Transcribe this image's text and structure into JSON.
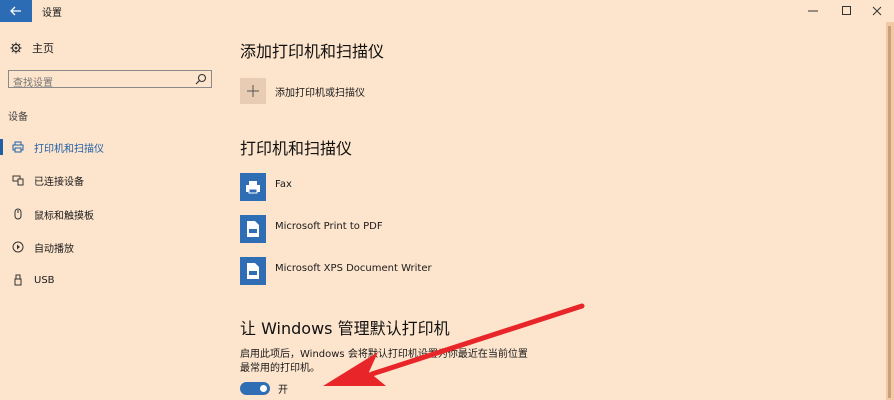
{
  "window": {
    "title": "设置",
    "minimize": "—",
    "maximize": "☐",
    "close": "✕"
  },
  "sidebar": {
    "home_label": "主页",
    "search": {
      "value": "",
      "placeholder": "查找设置"
    },
    "section_label": "设备",
    "items": [
      {
        "label": "打印机和扫描仪",
        "icon": "printer-icon",
        "active": true
      },
      {
        "label": "已连接设备",
        "icon": "connected-devices-icon",
        "active": false
      },
      {
        "label": "鼠标和触摸板",
        "icon": "mouse-icon",
        "active": false
      },
      {
        "label": "自动播放",
        "icon": "autoplay-icon",
        "active": false
      },
      {
        "label": "USB",
        "icon": "usb-icon",
        "active": false
      }
    ]
  },
  "main": {
    "add_heading": "添加打印机和扫描仪",
    "add_button_label": "添加打印机或扫描仪",
    "printers_heading": "打印机和扫描仪",
    "printers": [
      {
        "name": "Fax",
        "icon": "fax-icon"
      },
      {
        "name": "Microsoft Print to PDF",
        "icon": "printer-file-icon"
      },
      {
        "name": "Microsoft XPS Document Writer",
        "icon": "printer-file-icon"
      }
    ],
    "default_heading": "让 Windows 管理默认打印机",
    "default_desc_line1": "启用此项后，Windows 会将默认打印机设置为你最近在当前位置",
    "default_desc_line2": "最常用的打印机。",
    "toggle": {
      "state": "on",
      "label": "开"
    }
  },
  "colors": {
    "background": "#fde4cc",
    "accent": "#2f6db4",
    "annotation_arrow": "#e8262a"
  }
}
